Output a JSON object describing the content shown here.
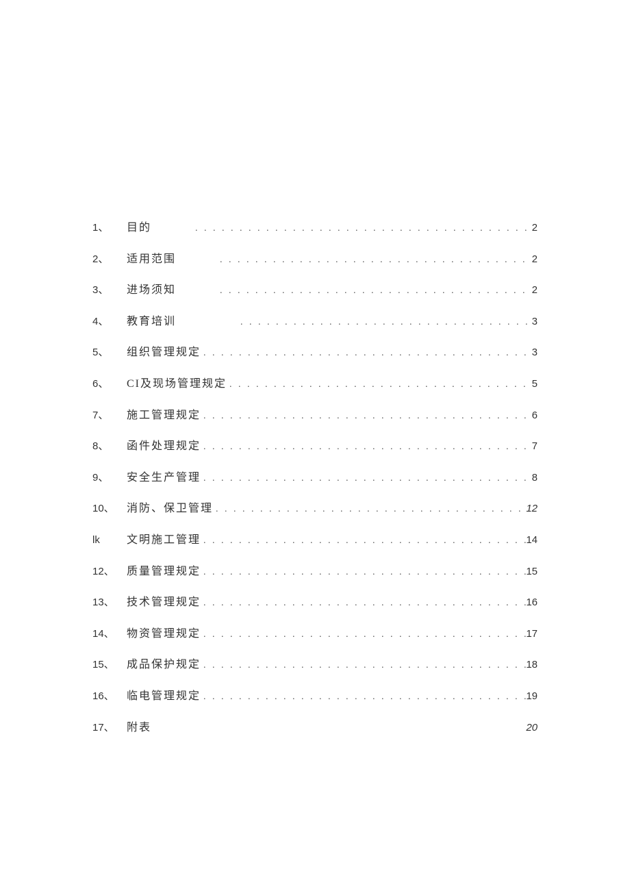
{
  "toc": {
    "entries": [
      {
        "num": "1、",
        "title": "目的",
        "page": "2",
        "gap": "gap-small",
        "italic": false,
        "offset": "",
        "leader": true
      },
      {
        "num": "2、",
        "title": "适用范围",
        "page": "2",
        "gap": "gap-small",
        "italic": false,
        "offset": "",
        "leader": true
      },
      {
        "num": "3、",
        "title": "进场须知",
        "page": "2",
        "gap": "gap-small",
        "italic": false,
        "offset": "",
        "leader": true
      },
      {
        "num": "4、",
        "title": "教育培训",
        "page": "3",
        "gap": "gap-small",
        "italic": false,
        "offset": "offset-1",
        "leader": true
      },
      {
        "num": "5、",
        "title": "组织管理规定",
        "page": "3",
        "gap": "",
        "italic": false,
        "offset": "",
        "leader": true
      },
      {
        "num": "6、",
        "title": "CI及现场管理规定",
        "page": "5",
        "gap": "",
        "italic": false,
        "offset": "",
        "leader": true
      },
      {
        "num": "7、",
        "title": "施工管理规定",
        "page": "6",
        "gap": "",
        "italic": false,
        "offset": "",
        "leader": true
      },
      {
        "num": "8、",
        "title": "函件处理规定",
        "page": "7",
        "gap": "",
        "italic": false,
        "offset": "",
        "leader": true
      },
      {
        "num": "9、",
        "title": "安全生产管理",
        "page": "8",
        "gap": "",
        "italic": false,
        "offset": "",
        "leader": true
      },
      {
        "num": "10、",
        "title": "消防、保卫管理",
        "page": "12",
        "gap": "",
        "italic": true,
        "offset": "",
        "leader": true
      },
      {
        "num": "lk",
        "title": "文明施工管理",
        "page": "14",
        "gap": "",
        "italic": false,
        "offset": "",
        "leader": true
      },
      {
        "num": "12、",
        "title": "质量管理规定",
        "page": "15",
        "gap": "",
        "italic": false,
        "offset": "",
        "leader": true
      },
      {
        "num": "13、",
        "title": "技术管理规定",
        "page": "16",
        "gap": "",
        "italic": false,
        "offset": "",
        "leader": true
      },
      {
        "num": "14、",
        "title": "物资管理规定",
        "page": "17",
        "gap": "",
        "italic": false,
        "offset": "",
        "leader": true
      },
      {
        "num": "15、",
        "title": "成品保护规定",
        "page": "18",
        "gap": "",
        "italic": false,
        "offset": "",
        "leader": true
      },
      {
        "num": "16、",
        "title": "临电管理规定",
        "page": "19",
        "gap": "",
        "italic": false,
        "offset": "",
        "leader": true
      },
      {
        "num": "17、",
        "title": "附表",
        "page": "20",
        "gap": "",
        "italic": true,
        "offset": "",
        "leader": false
      }
    ]
  }
}
